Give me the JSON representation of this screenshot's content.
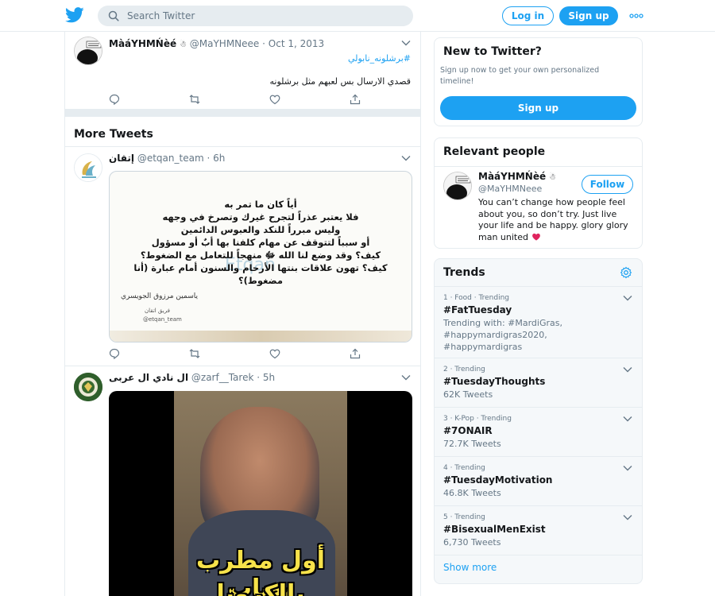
{
  "header": {
    "search_placeholder": "Search Twitter",
    "login_label": "Log in",
    "signup_label": "Sign up"
  },
  "colors": {
    "brand": "#1da1f2",
    "border": "#e6ecf0",
    "muted": "#657786",
    "heart": "#e0245e"
  },
  "first_tweet": {
    "name": "MàáYHMŃèé",
    "handle": "@MaYHMNeee",
    "date": "Oct 1, 2013",
    "hashtag": "#برشلونه_نابولي",
    "text": "قصدي الارسال بس لعبهم مثل برشلونه"
  },
  "more_tweets_label": "More Tweets",
  "tweet2": {
    "name": "إتقان",
    "handle": "@etqan_team",
    "age": "6h",
    "image_lines": [
      "أياً كان ما تمر به",
      "فلا يعتبر عذراً لتجرح غيرك وتصرخ في وجهه",
      "وليس مبرراً للنكد والعبوس الدائمين",
      "أو سبباً لتتوقف عن مهام كلفنا بها أبٌ أو مسؤول",
      "كيف؟ وقد وضع لنا الله ﷻ منهجاً للتعامل مع الضغوط؟",
      "كيف؟ تهون علاقات بنتها الأرحام والسنون أمام عبارة (أنا مضغوط)؟"
    ],
    "image_author": "ياسمين مرزوق الجويسري",
    "image_team": "فريق اتقان",
    "image_handle": "@etqan_team",
    "image_watermark": "Etqan"
  },
  "tweet3": {
    "name": "ال نادي ال عربى",
    "handle": "@zarf__Tarek",
    "age": "5h",
    "video_caption_1": "أول مطرب يصاب",
    "video_caption_2": "بالكرونا"
  },
  "new_to_twitter": {
    "title": "New to Twitter?",
    "text": "Sign up now to get your own personalized timeline!",
    "button": "Sign up"
  },
  "relevant_people": {
    "title": "Relevant people",
    "name": "MàáYHMŃèé",
    "handle": "@MaYHMNeee",
    "follow_label": "Follow",
    "bio": "You can’t change how people feel about you, so don’t try. Just live your life and be happy. glory glory man united"
  },
  "trends": {
    "title": "Trends",
    "items": [
      {
        "meta": "1 · Food · Trending",
        "name": "#FatTuesday",
        "with": "Trending with: #MardiGras, #happymardigras2020, #happymardigras",
        "count": ""
      },
      {
        "meta": "2 · Trending",
        "name": "#TuesdayThoughts",
        "with": "",
        "count": "62K Tweets"
      },
      {
        "meta": "3 · K-Pop · Trending",
        "name": "#7ONAIR",
        "with": "",
        "count": "72.7K Tweets"
      },
      {
        "meta": "4 · Trending",
        "name": "#TuesdayMotivation",
        "with": "",
        "count": "46.8K Tweets"
      },
      {
        "meta": "5 · Trending",
        "name": "#BisexualMenExist",
        "with": "",
        "count": "6,730 Tweets"
      }
    ],
    "show_more": "Show more"
  }
}
